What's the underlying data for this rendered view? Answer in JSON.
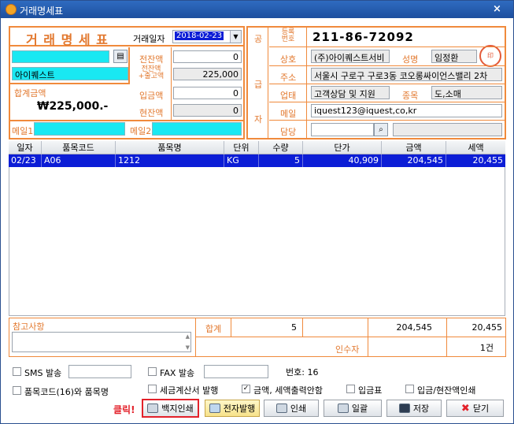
{
  "window": {
    "title": "거래명세표"
  },
  "header": {
    "doc_title": "거 래 명 세 표",
    "date_label": "거래일자",
    "date_value": "2018-02-23"
  },
  "buyer": {
    "name_value": "",
    "name2_value": "아이퀘스트",
    "prev_balance_label": "전잔액",
    "prev_balance_value": "0",
    "subtotal_label": "전잔액\n+출고액",
    "subtotal_value": "225,000",
    "deposit_label": "입금액",
    "deposit_value": "0",
    "current_balance_label": "현잔액",
    "current_balance_value": "0",
    "total_label": "합계금액",
    "total_value": "₩225,000.-",
    "email1_label": "메일1",
    "email2_label": "메일2"
  },
  "supplier": {
    "vertical_label": [
      "공",
      "급",
      "자"
    ],
    "reg_label": "등록\n번호",
    "reg_value": "211-86-72092",
    "company_label": "상호",
    "company_value": "(주)아이퀘스트서비",
    "rep_label": "성명",
    "rep_value": "임정환",
    "address_label": "주소",
    "address_value": "서울시 구로구 구로3동 코오롱싸이언스밸리 2차",
    "business_label": "업태",
    "business_value": "고객상담 및 지원",
    "type_label": "종목",
    "type_value": "도,소매",
    "mail_label": "메일",
    "mail_value": "iquest123@iquest,co,kr",
    "contact_label": "담당",
    "contact_value": ""
  },
  "table": {
    "columns": [
      "일자",
      "품목코드",
      "품목명",
      "단위",
      "수량",
      "단가",
      "금액",
      "세액"
    ],
    "rows": [
      [
        "02/23",
        "A06",
        "1212",
        "KG",
        "5",
        "40,909",
        "204,545",
        "20,455"
      ]
    ]
  },
  "summary": {
    "memo_label": "참고사항",
    "total_label": "합계",
    "total_qty": "5",
    "total_amount": "204,545",
    "total_tax": "20,455",
    "receiver_label": "인수자",
    "count": "1건"
  },
  "options": {
    "sms_label": "SMS 발송",
    "fax_label": "FAX 발송",
    "number_label": "번호: 16",
    "code_name_label": "품목코드(16)와 품목명",
    "tax_invoice_label": "세금계산서 발행",
    "amount_tax_label": "금액, 세액출력안함",
    "deposit_slip_label": "입금표",
    "deposit_balance_label": "입금/현잔액인쇄"
  },
  "buttons": {
    "click_hint": "클릭!",
    "plain_print": "백지인쇄",
    "e_issue": "전자발행",
    "print": "인쇄",
    "batch": "일괄",
    "save": "저장",
    "close": "닫기"
  }
}
